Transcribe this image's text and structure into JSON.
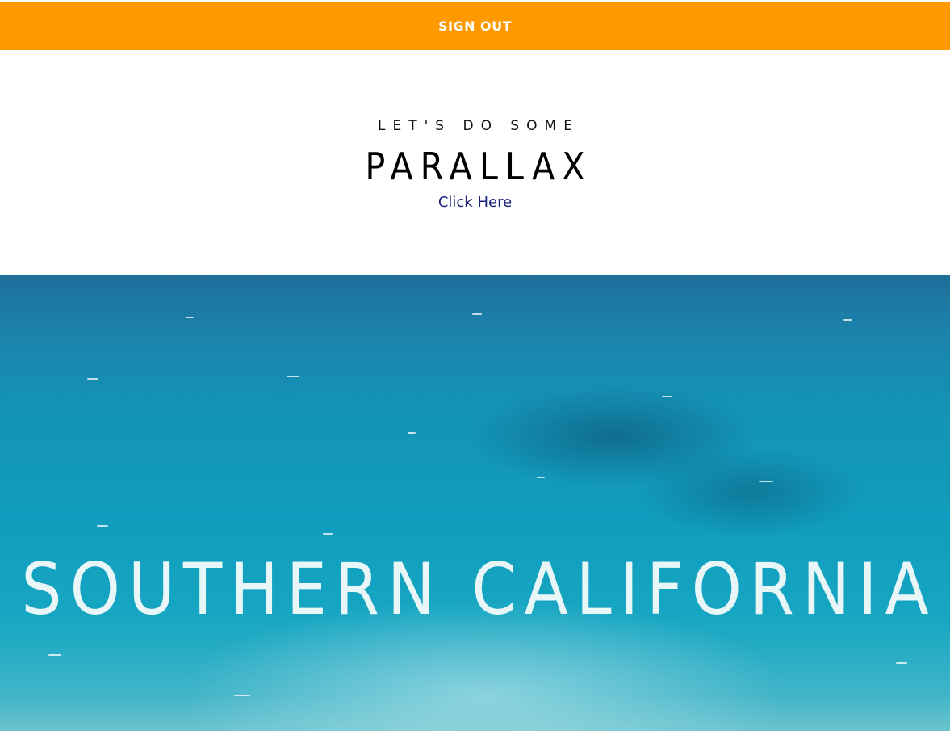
{
  "header": {
    "signout_label": "SIGN OUT",
    "background_color": "#ff9900"
  },
  "intro": {
    "kicker": "LET'S DO SOME",
    "title": "PARALLAX",
    "link_label": "Click Here",
    "link_color": "#1a237e"
  },
  "hero": {
    "image": "ocean-aerial-image",
    "title": "SOUTHERN CALIFORNIA"
  }
}
